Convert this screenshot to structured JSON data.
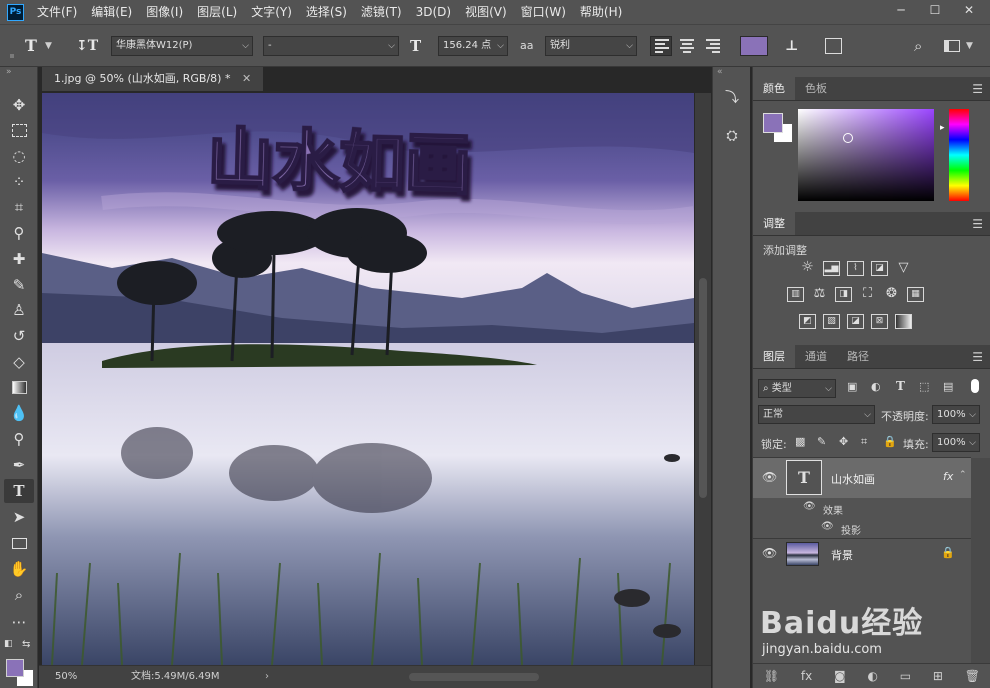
{
  "app": {
    "logo": "Ps"
  },
  "menu": [
    "文件(F)",
    "编辑(E)",
    "图像(I)",
    "图层(L)",
    "文字(Y)",
    "选择(S)",
    "滤镜(T)",
    "3D(D)",
    "视图(V)",
    "窗口(W)",
    "帮助(H)"
  ],
  "window": {
    "minimize": "─",
    "restore": "☐",
    "close": "✕"
  },
  "options": {
    "tool_glyph": "T",
    "font_family": "华康黑体W12(P)",
    "font_style": "-",
    "size_glyph": "T",
    "font_size": "156.24 点",
    "aa_glyph": "aa",
    "antialias": "锐利",
    "text_color": "#8a72b8"
  },
  "document": {
    "tab_title": "1.jpg @ 50% (山水如画, RGB/8) *",
    "canvas_text": "山水如画",
    "zoom": "50%",
    "doc_size": "文档:5.49M/6.49M"
  },
  "colors": {
    "foreground": "#8a72b8",
    "background": "#ffffff",
    "ui_panel": "#535353",
    "canvas_text_fill": "#8b72b5"
  },
  "color_panel": {
    "tabs": [
      "颜色",
      "色板"
    ]
  },
  "adjust_panel": {
    "title": "调整",
    "subtitle": "添加调整"
  },
  "layers_panel": {
    "tabs": [
      "图层",
      "通道",
      "路径"
    ],
    "filter_kind": "类型",
    "blend_mode": "正常",
    "opacity_label": "不透明度:",
    "opacity": "100%",
    "lock_label": "锁定:",
    "fill_label": "填充:",
    "fill": "100%",
    "layers": [
      {
        "name": "山水如画",
        "type": "text",
        "effects_label": "效果",
        "effects": [
          "投影"
        ],
        "fx": "fx"
      },
      {
        "name": "背景",
        "type": "image",
        "locked": true
      }
    ]
  },
  "watermark": {
    "brand": "Baidu经验",
    "url": "jingyan.baidu.com"
  }
}
